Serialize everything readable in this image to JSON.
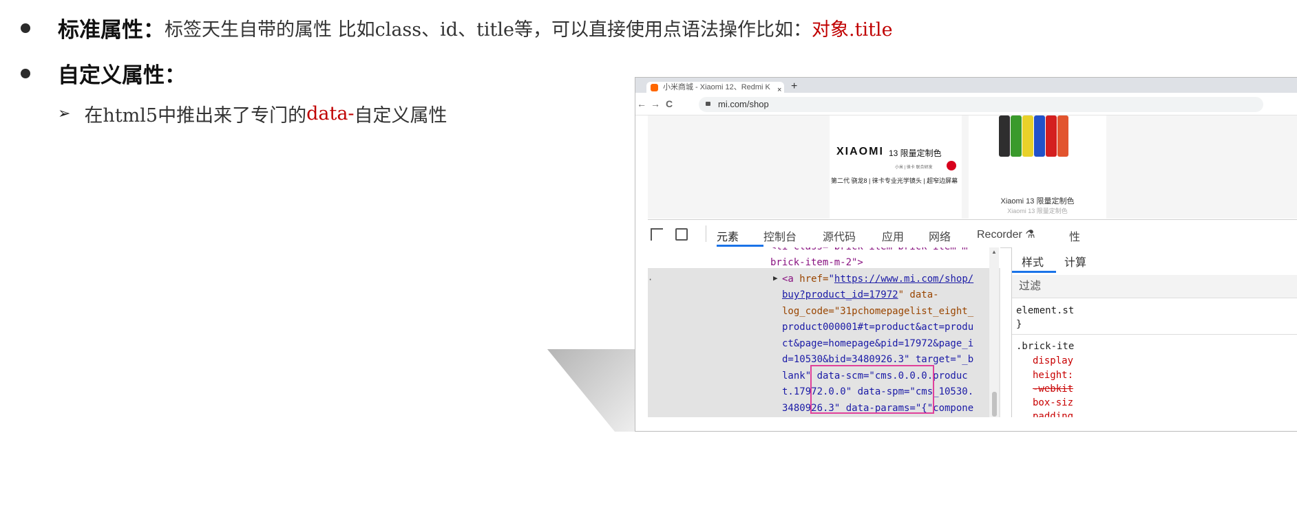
{
  "bullets": [
    {
      "heading": "标准属性：",
      "text": "标签天生自带的属性 比如class、id、title等，可以直接使用点语法操作比如：",
      "highlight": "对象.title"
    },
    {
      "heading": "自定义属性："
    }
  ],
  "sub_item": {
    "text_before": "在html5中推出来了专门的",
    "highlight": "data-",
    "text_after": "自定义属性"
  },
  "screenshot": {
    "browser_tab_title": "小米商城 - Xiaomi 12、Redmi K",
    "url": "mi.com/shop",
    "promo": {
      "brand": "XIAOMI",
      "model": "13 限量定制色",
      "tiny": "小米 | 徕卡 联合研发",
      "features": "第二代 骁龙8 | 徕卡专业光学镜头 | 超窄边屏幕"
    },
    "product": {
      "name": "Xiaomi 13 限量定制色",
      "subtitle": "Xiaomi 13 限量定制色",
      "colors": [
        "#2e2e2e",
        "#3a9a2c",
        "#e8d12a",
        "#2252c9",
        "#d41f1f",
        "#e2542e"
      ]
    },
    "devtools_tabs": [
      "元素",
      "控制台",
      "源代码",
      "应用",
      "网络",
      "Recorder ⚗",
      "性"
    ],
    "elements_code": {
      "line0": "<li class=\"brick-item brick-item-m",
      "line1": "brick-item-m-2\">",
      "line2_tag": "<a ",
      "line2_attr": "href=",
      "line2_link": "https://www.mi.com/shop/",
      "line3_link": "buy?product_id=17972",
      "line3_rest": "\" data-",
      "line4": "log_code=\"31pchomepagelist_eight_",
      "line5": "product000001#t=product&act=produ",
      "line6": "ct&page=homepage&pid=17972&page_i",
      "line7": "d=10530&bid=3480926.3\" target=\"_b",
      "line8": "lank\" data-scm=\"cms.0.0.0.produc",
      "line9": "t.17972.0.0\" data-spm=\"cms_10530.",
      "line10": "3480926.3\" data-params=\"{\"compone"
    },
    "styles_panel": {
      "tabs": [
        "样式",
        "计算"
      ],
      "filter": "过滤",
      "rule1_selector": "element.st",
      "rule1_close": "}",
      "rule2_selector": ".brick-ite",
      "props": [
        "display",
        "height:",
        "-webkit",
        "box-siz",
        "padding"
      ]
    }
  }
}
